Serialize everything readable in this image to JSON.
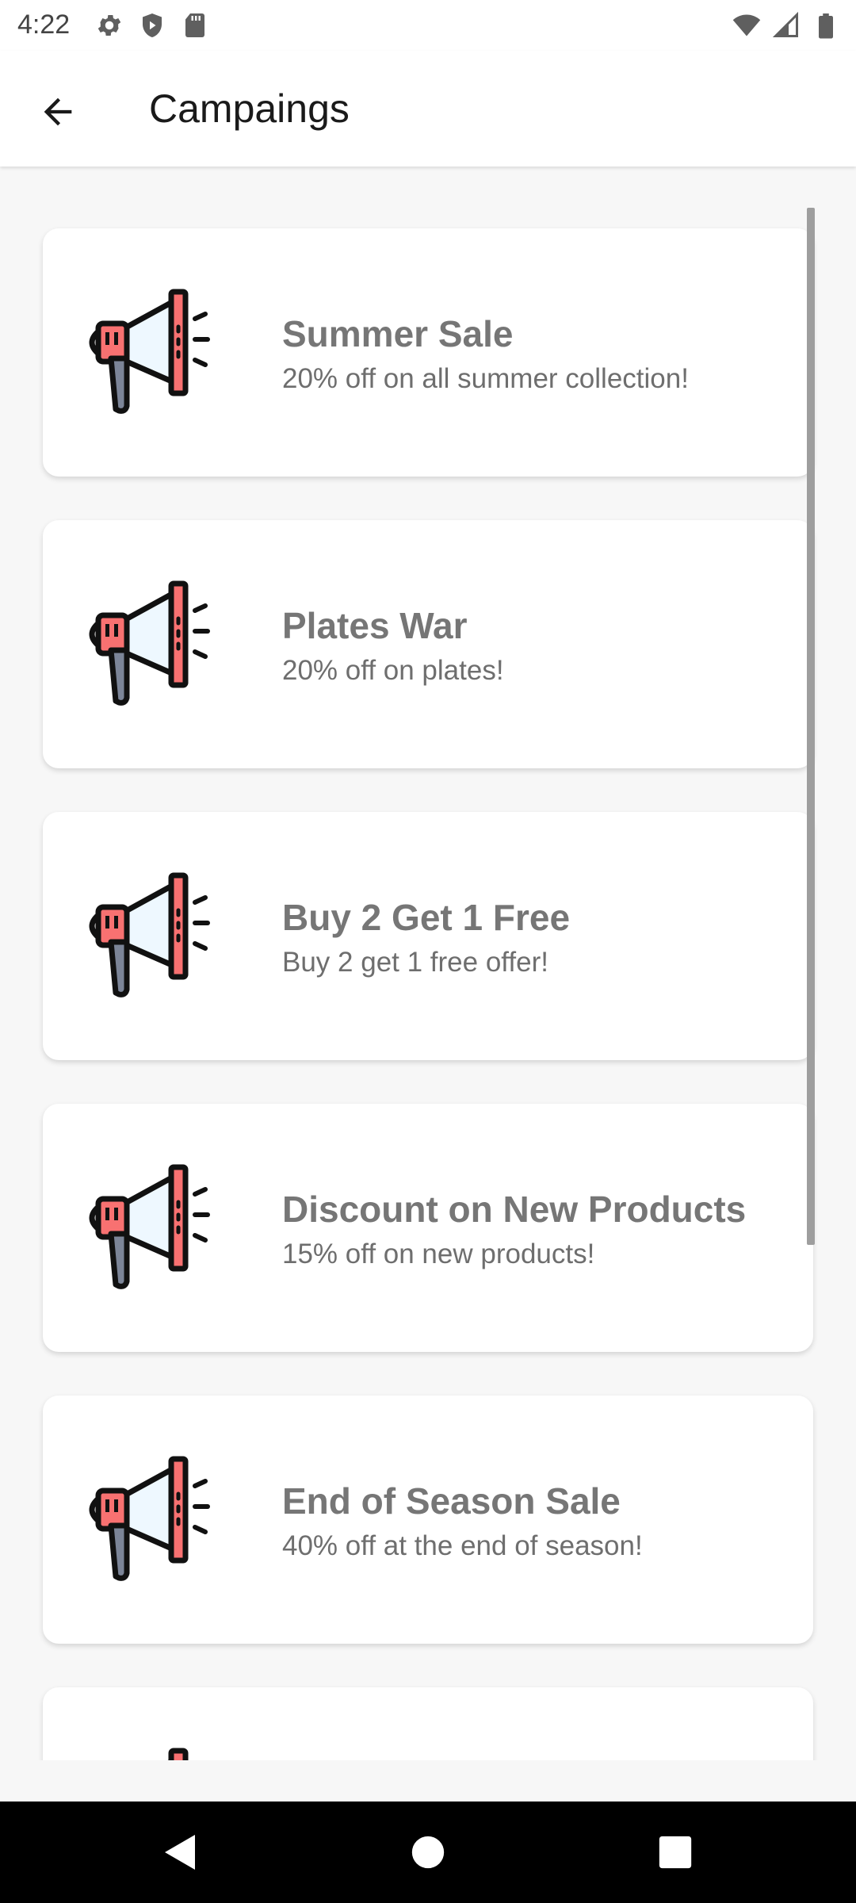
{
  "status": {
    "time": "4:22",
    "icons_left": [
      "gear-icon",
      "shield-icon",
      "sd-card-icon"
    ],
    "icons_right": [
      "wifi-icon",
      "signal-icon",
      "battery-icon"
    ]
  },
  "header": {
    "title": "Campaings",
    "back_icon": "arrow-left-icon"
  },
  "campaigns": [
    {
      "title": "Summer Sale",
      "subtitle": "20% off on all summer collection!",
      "icon": "megaphone-icon"
    },
    {
      "title": "Plates War",
      "subtitle": "20% off on plates!",
      "icon": "megaphone-icon"
    },
    {
      "title": "Buy 2 Get 1 Free",
      "subtitle": "Buy 2 get 1 free offer!",
      "icon": "megaphone-icon"
    },
    {
      "title": "Discount on New Products",
      "subtitle": "15% off on new products!",
      "icon": "megaphone-icon"
    },
    {
      "title": "End of Season Sale",
      "subtitle": "40% off at the end of season!",
      "icon": "megaphone-icon"
    },
    {
      "title": "",
      "subtitle": "",
      "icon": "megaphone-icon"
    }
  ],
  "navbar": {
    "buttons": [
      "back-triangle-icon",
      "home-circle-icon",
      "recents-square-icon"
    ]
  },
  "colors": {
    "megaphone_red": "#f87171",
    "megaphone_handle": "#7c8598",
    "megaphone_cone": "#eef8ff",
    "text_gray": "#767676"
  }
}
